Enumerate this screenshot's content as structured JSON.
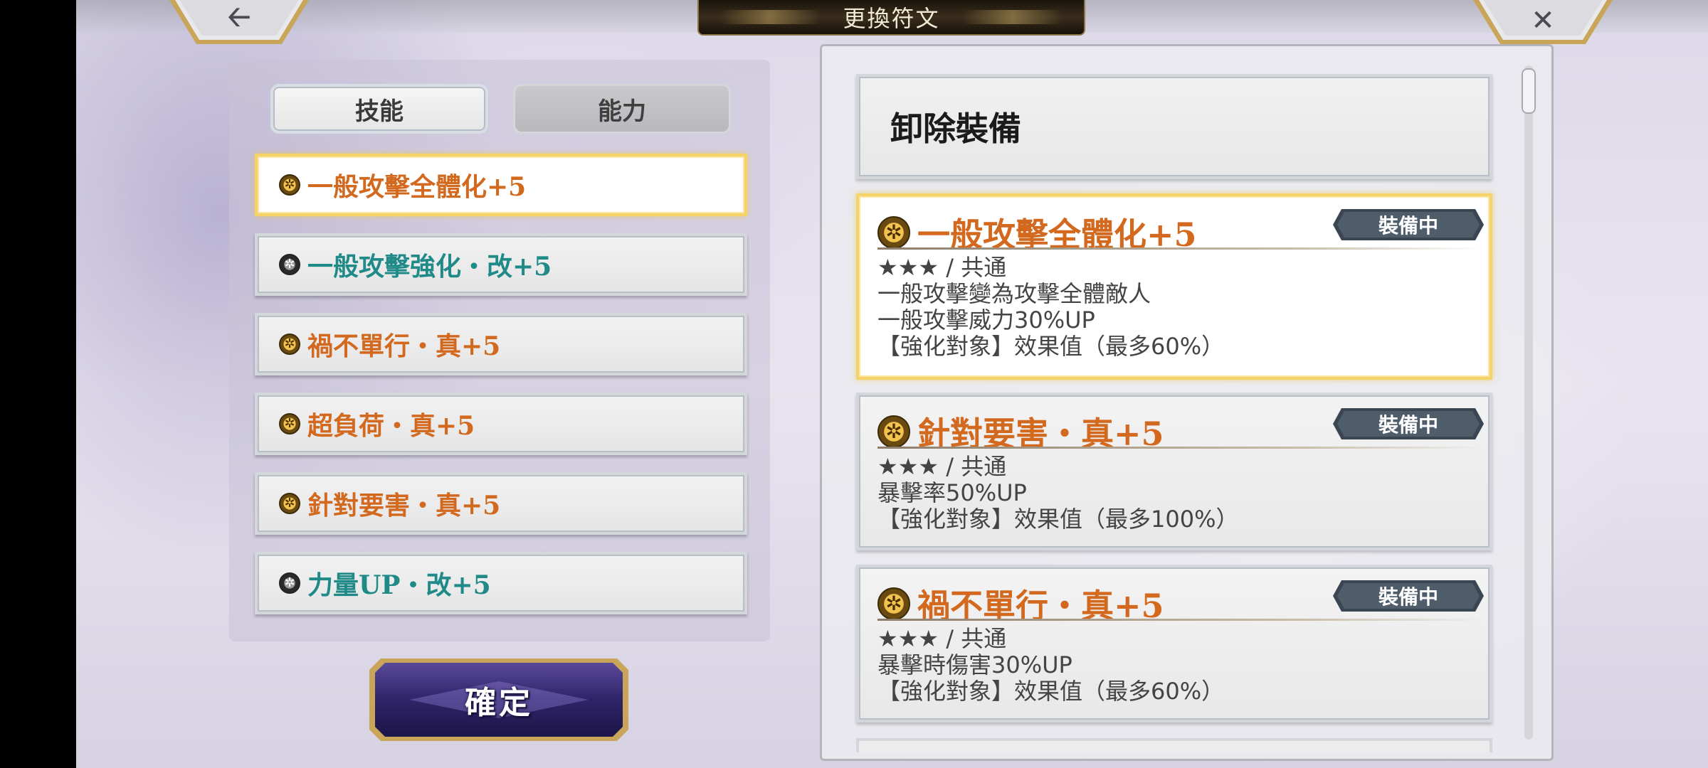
{
  "header": {
    "title": "更換符文",
    "back_icon": "arrow-left-icon",
    "close_icon": "close-icon"
  },
  "tabs": [
    {
      "label": "技能",
      "active": true
    },
    {
      "label": "能力",
      "active": false
    }
  ],
  "skills": [
    {
      "label": "一般攻擊全體化+5",
      "color": "#d2691e",
      "rune": "gold",
      "selected": true
    },
    {
      "label": "一般攻擊強化・改+5",
      "color": "#1f8a87",
      "rune": "dark",
      "selected": false
    },
    {
      "label": "禍不單行・真+5",
      "color": "#d2691e",
      "rune": "gold",
      "selected": false
    },
    {
      "label": "超負荷・真+5",
      "color": "#d2691e",
      "rune": "gold",
      "selected": false
    },
    {
      "label": "針對要害・真+5",
      "color": "#d2691e",
      "rune": "gold",
      "selected": false
    },
    {
      "label": "力量UP・改+5",
      "color": "#1f8a87",
      "rune": "dark",
      "selected": false
    }
  ],
  "confirm_label": "確定",
  "unequip_label": "卸除裝備",
  "cards": [
    {
      "name": "一般攻擊全體化+5",
      "badge": "裝備中",
      "lines": [
        "★★★ / 共通",
        "一般攻擊變為攻擊全體敵人",
        "一般攻擊威力30%UP",
        "【強化對象】效果值（最多60%）"
      ]
    },
    {
      "name": "針對要害・真+5",
      "badge": "裝備中",
      "lines": [
        "★★★ / 共通",
        "暴擊率50%UP",
        "【強化對象】效果值（最多100%）"
      ]
    },
    {
      "name": "禍不單行・真+5",
      "badge": "裝備中",
      "lines": [
        "★★★ / 共通",
        "暴擊時傷害30%UP",
        "【強化對象】效果值（最多60%）"
      ]
    }
  ]
}
